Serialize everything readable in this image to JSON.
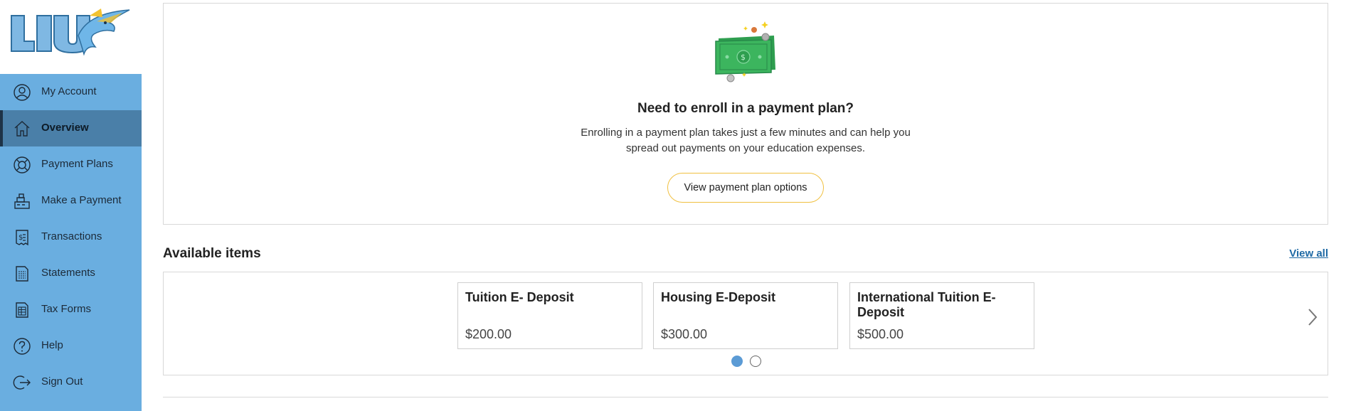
{
  "sidebar": {
    "logo_alt": "LIU",
    "items": [
      {
        "label": "My Account",
        "icon": "user-circle-icon",
        "active": false
      },
      {
        "label": "Overview",
        "icon": "home-icon",
        "active": true
      },
      {
        "label": "Payment Plans",
        "icon": "lifebuoy-icon",
        "active": false
      },
      {
        "label": "Make a Payment",
        "icon": "cash-register-icon",
        "active": false
      },
      {
        "label": "Transactions",
        "icon": "receipt-dollar-icon",
        "active": false
      },
      {
        "label": "Statements",
        "icon": "statement-document-icon",
        "active": false
      },
      {
        "label": "Tax Forms",
        "icon": "tax-form-icon",
        "active": false
      },
      {
        "label": "Help",
        "icon": "help-icon",
        "active": false
      },
      {
        "label": "Sign Out",
        "icon": "sign-out-icon",
        "active": false
      }
    ]
  },
  "enroll": {
    "title": "Need to enroll in a payment plan?",
    "desc_line1": "Enrolling in a payment plan takes just a few minutes and can help you",
    "desc_line2": "spread out payments on your education expenses.",
    "button_label": "View payment plan options"
  },
  "available": {
    "title": "Available items",
    "view_all": "View all",
    "items": [
      {
        "name": "Tuition E- Deposit",
        "price": "$200.00"
      },
      {
        "name": "Housing E-Deposit",
        "price": "$300.00"
      },
      {
        "name": "International Tuition E-Deposit",
        "price": "$500.00"
      }
    ],
    "pages": 2,
    "current_page": 1
  },
  "colors": {
    "sidebar_bg": "#6aaee0",
    "sidebar_active": "#4a7fa8",
    "accent_link": "#1f6aa5",
    "button_border": "#f0c040",
    "dot_active": "#5b9bd5"
  }
}
